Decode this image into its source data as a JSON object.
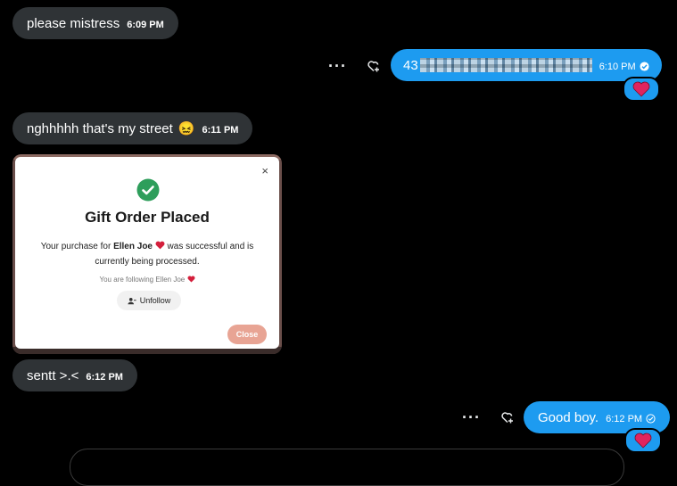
{
  "messages": [
    {
      "text": "please mistress",
      "time": "6:09 PM"
    },
    {
      "text": "43",
      "time": "6:10 PM",
      "redacted_note": ""
    },
    {
      "text": "nghhhhh that's my street",
      "time": "6:11 PM",
      "emoji": "😖"
    },
    {
      "text": "sentt >.<",
      "time": "6:12 PM"
    },
    {
      "text": "Good boy.",
      "time": "6:12 PM"
    }
  ],
  "actions": {
    "more": "···"
  },
  "modal": {
    "close_x": "×",
    "title": "Gift Order Placed",
    "msg_prefix": "Your purchase for",
    "recipient": "Ellen Joe",
    "msg_suffix": "was successful and is currently being processed.",
    "following": "You are following Ellen Joe",
    "unfollow_label": "Unfollow",
    "close_label": "Close"
  },
  "colors": {
    "sent_bubble": "#1d9bf0",
    "received_bubble": "#2f3336",
    "reaction_heart": "#e0245e",
    "success_green": "#2e9e5b",
    "close_button": "#e8a494"
  },
  "icons": [
    "more-icon",
    "add-reaction-icon",
    "heart-reaction-icon",
    "check-circle-icon",
    "close-icon",
    "person-minus-icon"
  ]
}
